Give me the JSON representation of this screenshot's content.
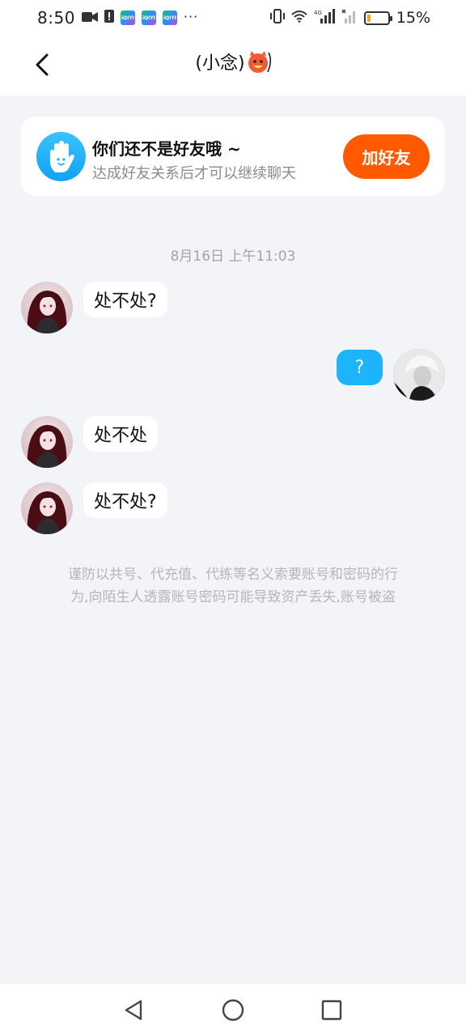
{
  "status_bar": {
    "time": "8:50",
    "app_badge_text": "iQIYI",
    "more_dots": "···",
    "network_label": "4G",
    "battery_text": "15%",
    "battery_level": 0.15,
    "battery_color": "#f5a623"
  },
  "header": {
    "title": "(小念)",
    "back_icon": "chevron-left-icon",
    "title_emoji": "devil-face-emoji"
  },
  "friend_card": {
    "title": "你们还不是好友哦 ~",
    "subtitle": "达成好友关系后才可以继续聊天",
    "button_label": "加好友",
    "button_color": "#ff5a00",
    "icon": "waving-hand-icon"
  },
  "chat": {
    "timestamp": "8月16日 上午11:03",
    "messages": [
      {
        "side": "left",
        "text": "处不处?"
      },
      {
        "side": "right",
        "text": "?"
      },
      {
        "side": "left",
        "text": "处不处"
      },
      {
        "side": "left",
        "text": "处不处?"
      }
    ],
    "bubble_self_color": "#1eb4fb"
  },
  "warning": {
    "line1": "谨防以共号、代充值、代练等名义索要账号和密码的行",
    "line2": "为,向陌生人透露账号密码可能导致资产丢失,账号被盗"
  },
  "nav_bar": {
    "back": "triangle-back-icon",
    "home": "circle-home-icon",
    "recents": "square-recents-icon"
  }
}
